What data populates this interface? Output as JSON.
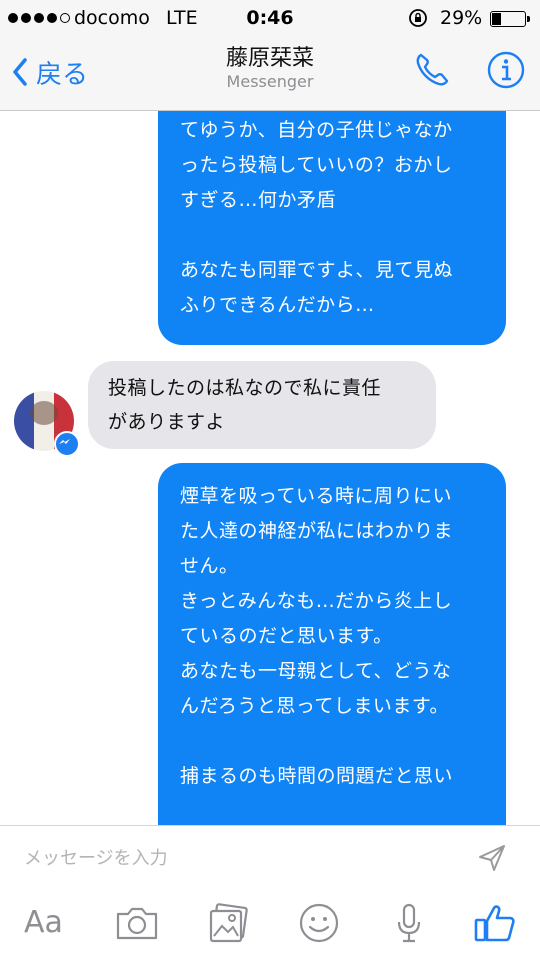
{
  "status_bar": {
    "carrier": "docomo",
    "network": "LTE",
    "time": "0:46",
    "battery_percent": "29%",
    "battery_level": 0.29
  },
  "nav": {
    "back_label": "戻る",
    "title": "藤原栞菜",
    "subtitle": "Messenger"
  },
  "messages": {
    "out1": {
      "lines": [
        "てゆうか、自分の子供じゃなか",
        "ったら投稿していいの？おかし",
        "すぎる…何か矛盾"
      ],
      "lines2": [
        "あなたも同罪ですよ、見て見ぬ",
        "ふりできるんだから…"
      ]
    },
    "in1": {
      "lines": [
        "投稿したのは私なので私に責任",
        "がありますよ"
      ]
    },
    "out2": {
      "lines": [
        "煙草を吸っている時に周りにい",
        "た人達の神経が私にはわかりま",
        "せん。",
        "きっとみんなも…だから炎上し",
        "ているのだと思います。",
        "あなたも一母親として、どうな",
        "んだろうと思ってしまいます。"
      ],
      "lines2": [
        "捕まるのも時間の問題だと思い"
      ]
    }
  },
  "composer": {
    "placeholder": "メッセージを入力",
    "aa_label": "Aa"
  },
  "colors": {
    "accent": "#1e7ff2",
    "outgoing_bubble": "#1083f5",
    "incoming_bubble": "#e5e5ea"
  },
  "icons": [
    "signal-dots",
    "lock-rotation-icon",
    "battery-icon",
    "chevron-left-icon",
    "phone-icon",
    "info-icon",
    "messenger-badge-icon",
    "send-icon",
    "camera-icon",
    "photo-icon",
    "smile-icon",
    "microphone-icon",
    "thumbs-up-icon"
  ]
}
